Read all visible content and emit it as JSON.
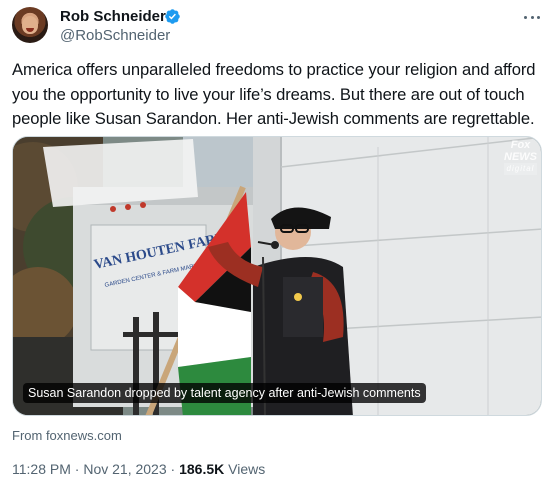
{
  "author": {
    "name": "Rob Schneider",
    "handle": "@RobSchneider"
  },
  "tweet": {
    "text": "America offers unparalleled freedoms to practice your religion and afford you the opportunity to live your life’s dreams. But there are out of touch people like Susan Sarandon. Her anti-Jewish comments are regrettable."
  },
  "media": {
    "caption": "Susan Sarandon dropped by talent agency after anti-Jewish comments",
    "watermark_line1": "Fox",
    "watermark_line2": "NEWS",
    "watermark_line3": "digital",
    "truck_sign_line1": "VAN HOUTEN FARMS",
    "truck_sign_line2": "GARDEN CENTER & FARM MARKET"
  },
  "link_source": "From foxnews.com",
  "meta": {
    "time": "11:28 PM",
    "separator": "·",
    "date": "Nov 21, 2023",
    "views_count": "186.5K",
    "views_label": "Views"
  },
  "colors": {
    "verified": "#1d9bf0",
    "secondary_text": "#536471",
    "flag_red": "#d4312b",
    "flag_green": "#2d8a3e"
  }
}
